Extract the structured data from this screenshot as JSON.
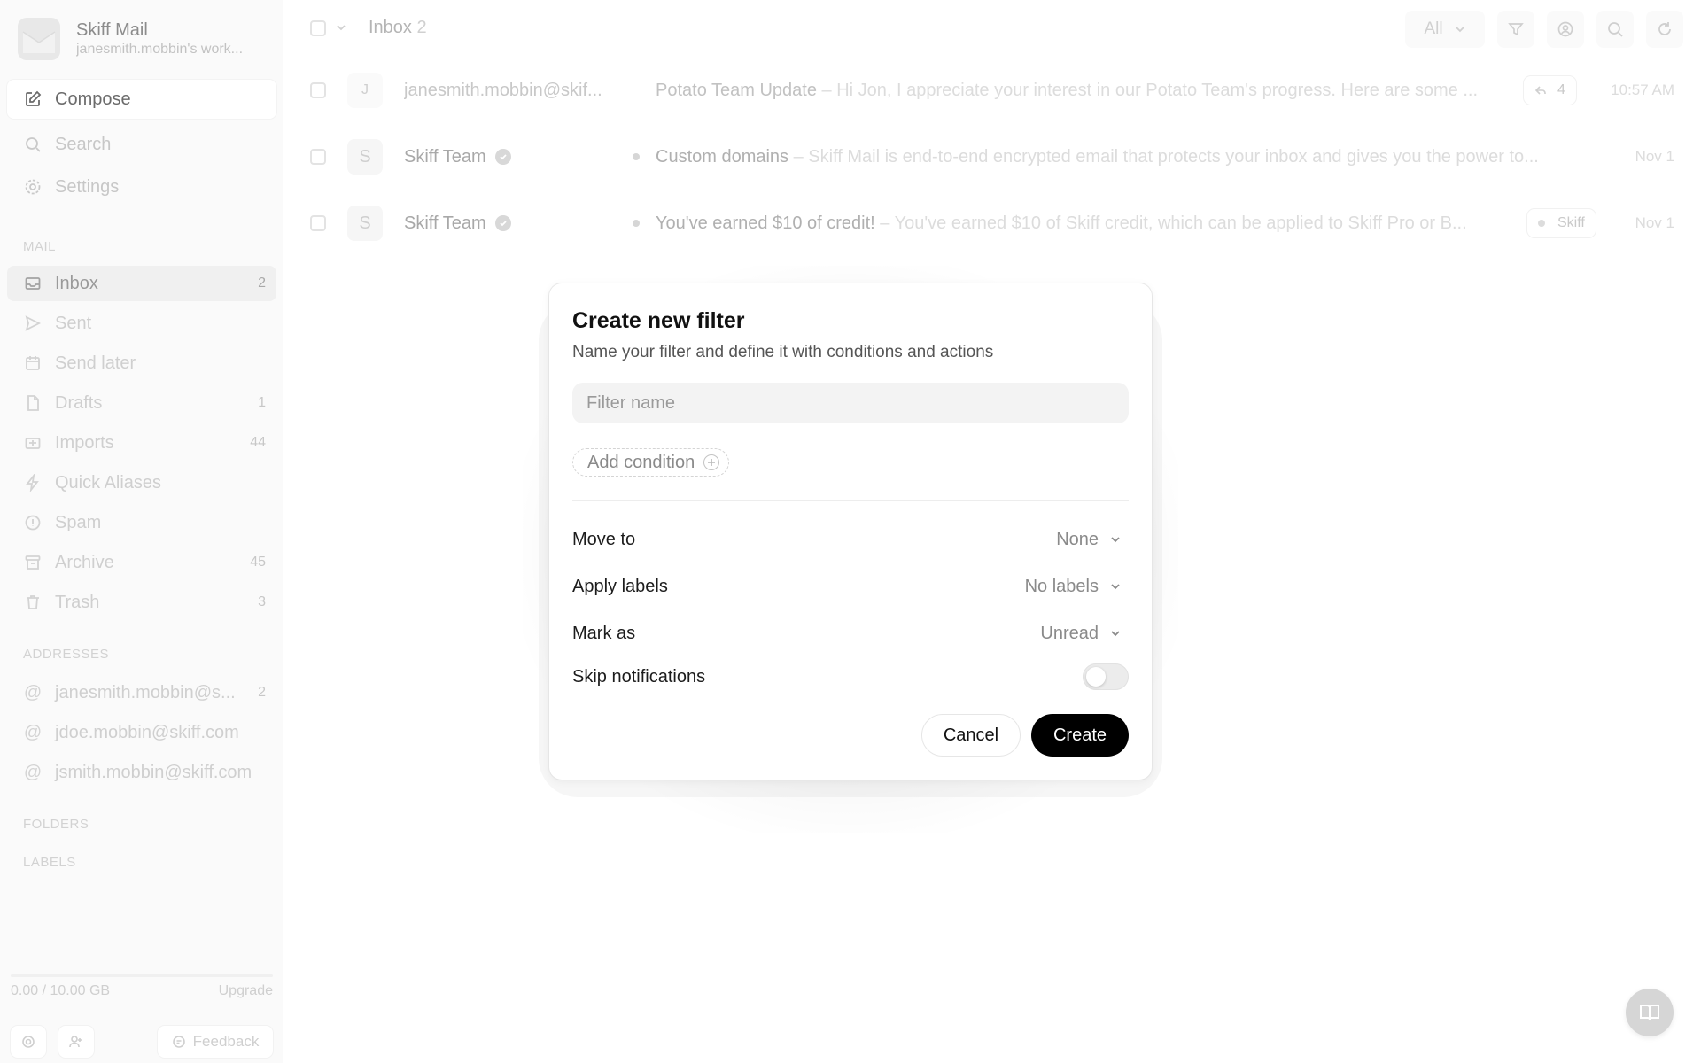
{
  "account": {
    "name": "Skiff Mail",
    "subtitle": "janesmith.mobbin's work..."
  },
  "nav_top": {
    "compose": "Compose",
    "search": "Search",
    "settings": "Settings"
  },
  "sections": {
    "mail": "MAIL",
    "addresses": "ADDRESSES",
    "folders": "FOLDERS",
    "labels": "LABELS"
  },
  "mail_items": [
    {
      "label": "Inbox",
      "count": "2",
      "icon": "inbox-icon"
    },
    {
      "label": "Sent",
      "count": "",
      "icon": "send-icon"
    },
    {
      "label": "Send later",
      "count": "",
      "icon": "calendar-icon"
    },
    {
      "label": "Drafts",
      "count": "1",
      "icon": "file-icon"
    },
    {
      "label": "Imports",
      "count": "44",
      "icon": "import-icon"
    },
    {
      "label": "Quick Aliases",
      "count": "",
      "icon": "bolt-icon"
    },
    {
      "label": "Spam",
      "count": "",
      "icon": "alert-icon"
    },
    {
      "label": "Archive",
      "count": "45",
      "icon": "archive-icon"
    },
    {
      "label": "Trash",
      "count": "3",
      "icon": "trash-icon"
    }
  ],
  "addresses": [
    {
      "label": "janesmith.mobbin@s...",
      "count": "2"
    },
    {
      "label": "jdoe.mobbin@skiff.com",
      "count": ""
    },
    {
      "label": "jsmith.mobbin@skiff.com",
      "count": ""
    }
  ],
  "storage": {
    "used": "0.00 / 10.00 GB",
    "upgrade": "Upgrade",
    "fraction": 0.0
  },
  "footer": {
    "feedback": "Feedback"
  },
  "inbox": {
    "title": "Inbox",
    "count": "2",
    "filter_value": "All"
  },
  "emails": [
    {
      "avatar": "J",
      "sender": "janesmith.mobbin@skif...",
      "subject": "Potato Team Update",
      "preview": " – Hi Jon, I appreciate your interest in our Potato Team's progress. Here are some ...",
      "thread_count": "4",
      "date": "10:57 AM"
    },
    {
      "avatar": "S",
      "sender": "Skiff Team",
      "subject": "Custom domains",
      "preview": " – Skiff Mail is end-to-end encrypted email that protects your inbox and gives you the power to...",
      "date": "Nov 1"
    },
    {
      "avatar": "S",
      "sender": "Skiff Team",
      "subject": "You've earned $10 of credit!",
      "preview": " – You've earned $10 of Skiff credit, which can be applied to Skiff Pro or B...",
      "label": "Skiff",
      "date": "Nov 1"
    }
  ],
  "modal": {
    "title": "Create new filter",
    "description": "Name your filter and define it with conditions and actions",
    "filter_name_placeholder": "Filter name",
    "add_condition": "Add condition",
    "options": {
      "move_to": {
        "label": "Move to",
        "value": "None"
      },
      "apply_labels": {
        "label": "Apply labels",
        "value": "No labels"
      },
      "mark_as": {
        "label": "Mark as",
        "value": "Unread"
      },
      "skip_notifications": {
        "label": "Skip notifications",
        "enabled": false
      }
    },
    "cancel": "Cancel",
    "create": "Create"
  },
  "colors": {
    "primary_button": "#000000",
    "background": "#ffffff",
    "sidebar": "#fafafa"
  }
}
